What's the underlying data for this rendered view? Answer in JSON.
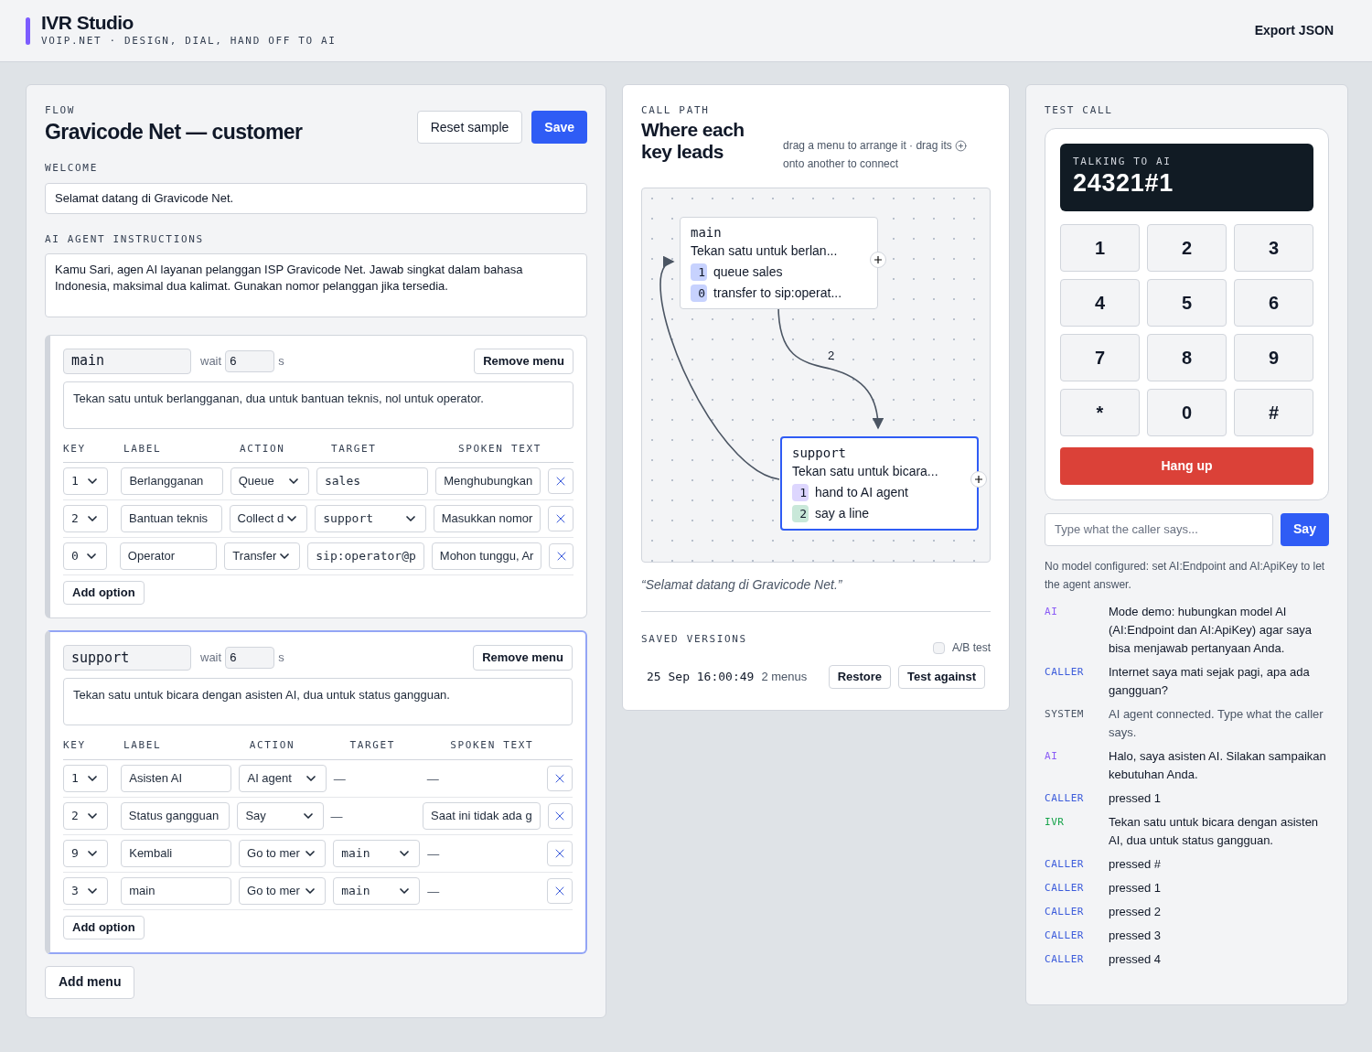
{
  "header": {
    "title": "IVR Studio",
    "subtitle": "VOIP.NET · DESIGN, DIAL, HAND OFF TO AI",
    "export": "Export JSON"
  },
  "flow": {
    "eyebrow": "FLOW",
    "title": "Gravicode Net — customer",
    "reset": "Reset sample",
    "save": "Save",
    "welcome_label": "WELCOME",
    "welcome": "Selamat datang di Gravicode Net.",
    "instructions_label": "AI AGENT INSTRUCTIONS",
    "instructions": "Kamu Sari, agen AI layanan pelanggan ISP Gravicode Net. Jawab singkat dalam bahasa Indonesia, maksimal dua kalimat. Gunakan nomor pelanggan jika tersedia.",
    "menus": [
      {
        "name": "main",
        "wait_label": "wait",
        "wait": "6",
        "unit": "s",
        "remove": "Remove menu",
        "selected": false,
        "prompt": "Tekan satu untuk berlangganan, dua untuk bantuan teknis, nol untuk operator.",
        "columns": [
          "KEY",
          "LABEL",
          "ACTION",
          "TARGET",
          "SPOKEN TEXT"
        ],
        "options": [
          {
            "key": "1",
            "label": "Berlangganan",
            "action": "Queue",
            "target": {
              "kind": "input",
              "value": "sales"
            },
            "spoken": {
              "kind": "input",
              "value": "Menghubungkan"
            }
          },
          {
            "key": "2",
            "label": "Bantuan teknis",
            "action": "Collect d",
            "target": {
              "kind": "select",
              "value": "support"
            },
            "spoken": {
              "kind": "input",
              "value": "Masukkan nomor"
            }
          },
          {
            "key": "0",
            "label": "Operator",
            "action": "Transfer",
            "target": {
              "kind": "input",
              "value": "sip:operator@p"
            },
            "spoken": {
              "kind": "input",
              "value": "Mohon tunggu, Ar"
            }
          }
        ],
        "add": "Add option"
      },
      {
        "name": "support",
        "wait_label": "wait",
        "wait": "6",
        "unit": "s",
        "remove": "Remove menu",
        "selected": true,
        "prompt": "Tekan satu untuk bicara dengan asisten AI, dua untuk status gangguan.",
        "columns": [
          "KEY",
          "LABEL",
          "ACTION",
          "TARGET",
          "SPOKEN TEXT"
        ],
        "options": [
          {
            "key": "1",
            "label": "Asisten AI",
            "action": "AI agent",
            "target": {
              "kind": "none",
              "value": "—"
            },
            "spoken": {
              "kind": "none",
              "value": "—"
            }
          },
          {
            "key": "2",
            "label": "Status gangguan",
            "action": "Say",
            "target": {
              "kind": "none",
              "value": "—"
            },
            "spoken": {
              "kind": "input",
              "value": "Saat ini tidak ada g"
            }
          },
          {
            "key": "9",
            "label": "Kembali",
            "action": "Go to mer",
            "target": {
              "kind": "select",
              "value": "main"
            },
            "spoken": {
              "kind": "none",
              "value": "—"
            }
          },
          {
            "key": "3",
            "label": "main",
            "action": "Go to mer",
            "target": {
              "kind": "select",
              "value": "main"
            },
            "spoken": {
              "kind": "none",
              "value": "—"
            }
          }
        ],
        "add": "Add option"
      }
    ],
    "add_menu": "Add menu"
  },
  "path": {
    "eyebrow": "CALL PATH",
    "title": "Where each key leads",
    "hint_a": "drag a menu to arrange it · drag its",
    "hint_b": "onto another to connect",
    "nodes": [
      {
        "name": "main",
        "prompt": "Tekan satu untuk berlan...",
        "selected": false,
        "options": [
          {
            "key": "1",
            "text": "queue sales",
            "color": "#c7d2fe"
          },
          {
            "key": "0",
            "text": "transfer to sip:operat...",
            "color": "#c7d2fe"
          }
        ]
      },
      {
        "name": "support",
        "prompt": "Tekan satu untuk bicara...",
        "selected": true,
        "options": [
          {
            "key": "1",
            "text": "hand to AI agent",
            "color": "#ddd6fe"
          },
          {
            "key": "2",
            "text": "say a line",
            "color": "#c9e8d9"
          }
        ]
      }
    ],
    "edges": [
      {
        "kind": "down",
        "label": "2"
      },
      {
        "kind": "back"
      }
    ],
    "welcome": "“Selamat datang di Gravicode Net.”",
    "versions_label": "SAVED VERSIONS",
    "ab_label": "A/B test",
    "ab_checked": false,
    "versions": [
      {
        "time": "25 Sep 16:00:49",
        "menus": "2 menus",
        "restore": "Restore",
        "test": "Test against"
      }
    ]
  },
  "test": {
    "eyebrow": "TEST CALL",
    "status": "TALKING TO AI",
    "digits": "24321#1",
    "keys": [
      "1",
      "2",
      "3",
      "4",
      "5",
      "6",
      "7",
      "8",
      "9",
      "*",
      "0",
      "#"
    ],
    "hangup": "Hang up",
    "input_placeholder": "Type what the caller says...",
    "say": "Say",
    "notice": "No model configured: set AI:Endpoint and AI:ApiKey to let the agent answer.",
    "log": [
      {
        "kind": "ai",
        "role": "AI",
        "text": "Mode demo: hubungkan model AI (AI:Endpoint dan AI:ApiKey) agar saya bisa menjawab pertanyaan Anda."
      },
      {
        "kind": "caller",
        "role": "CALLER",
        "text": "Internet saya mati sejak pagi, apa ada gangguan?"
      },
      {
        "kind": "system",
        "role": "SYSTEM",
        "text": "AI agent connected. Type what the caller says."
      },
      {
        "kind": "ai",
        "role": "AI",
        "text": "Halo, saya asisten AI. Silakan sampaikan kebutuhan Anda."
      },
      {
        "kind": "caller",
        "role": "CALLER",
        "text": "pressed 1"
      },
      {
        "kind": "ivr",
        "role": "IVR",
        "text": "Tekan satu untuk bicara dengan asisten AI, dua untuk status gangguan."
      },
      {
        "kind": "caller",
        "role": "CALLER",
        "text": "pressed #"
      },
      {
        "kind": "caller",
        "role": "CALLER",
        "text": "pressed 1"
      },
      {
        "kind": "caller",
        "role": "CALLER",
        "text": "pressed 2"
      },
      {
        "kind": "caller",
        "role": "CALLER",
        "text": "pressed 3"
      },
      {
        "kind": "caller",
        "role": "CALLER",
        "text": "pressed 4"
      }
    ]
  }
}
